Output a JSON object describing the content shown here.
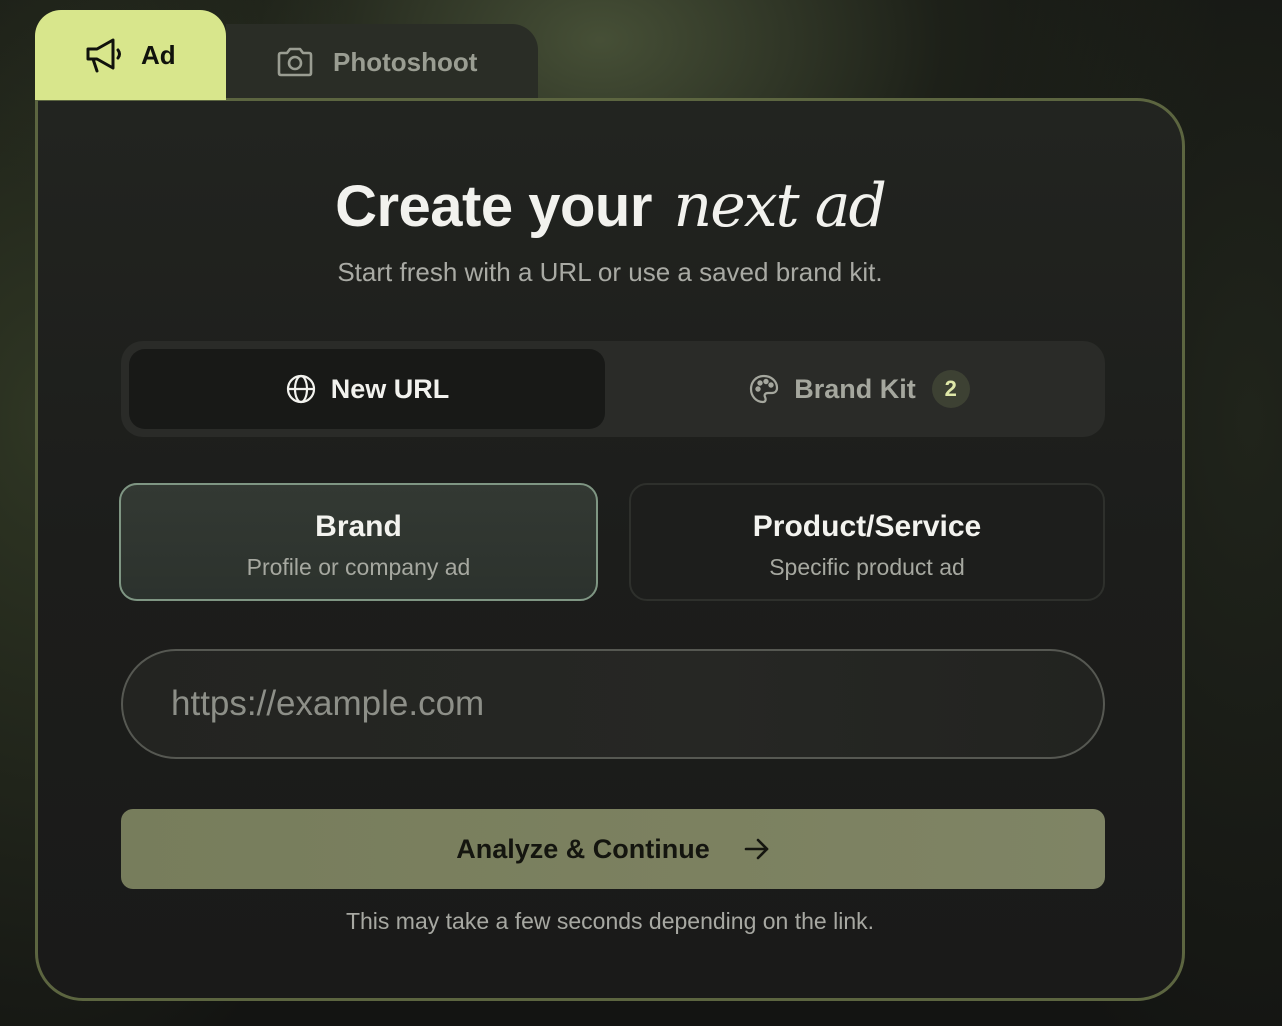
{
  "tabs": [
    {
      "label": "Ad",
      "icon": "megaphone-icon",
      "active": true
    },
    {
      "label": "Photoshoot",
      "icon": "camera-icon",
      "active": false
    }
  ],
  "card": {
    "title_main": "Create your",
    "title_accent": "next ad",
    "subtitle": "Start fresh with a URL or use a saved brand kit."
  },
  "source_toggle": {
    "options": [
      {
        "label": "New URL",
        "icon": "globe-icon",
        "selected": true
      },
      {
        "label": "Brand Kit",
        "icon": "palette-icon",
        "selected": false,
        "badge": "2"
      }
    ]
  },
  "ad_type": {
    "options": [
      {
        "title": "Brand",
        "subtitle": "Profile or company ad",
        "selected": true
      },
      {
        "title": "Product/Service",
        "subtitle": "Specific product ad",
        "selected": false
      }
    ]
  },
  "url_input": {
    "value": "",
    "placeholder": "https://example.com"
  },
  "submit": {
    "label": "Analyze & Continue",
    "icon": "arrow-right-icon"
  },
  "hint": "This may take a few seconds depending on the link.",
  "colors": {
    "tab_active": "#d8e68c",
    "card_border": "#5c6540",
    "submit_bg": "#7c8160",
    "selected_option_border": "#7f9683"
  }
}
